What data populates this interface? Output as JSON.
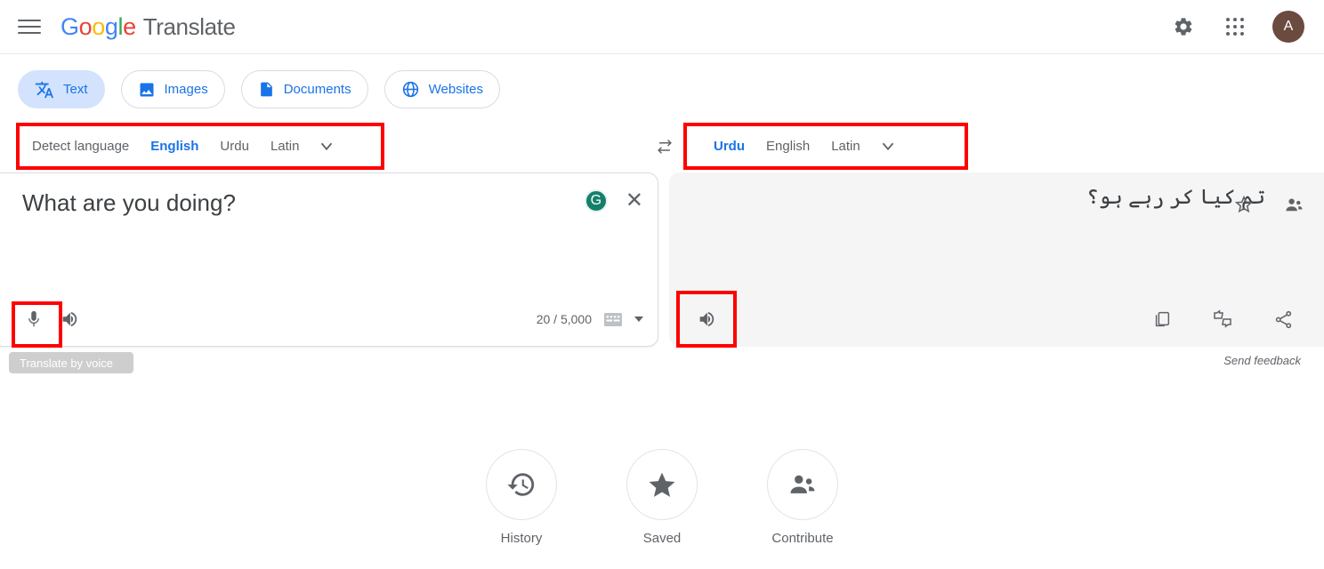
{
  "header": {
    "menu_icon": "hamburger-menu-icon",
    "logo_letters": [
      "G",
      "o",
      "o",
      "g",
      "l",
      "e"
    ],
    "brand_word": "Translate",
    "settings_icon": "gear-icon",
    "apps_icon": "apps-grid-icon",
    "avatar_letter": "A",
    "avatar_color": "#6b4a3f"
  },
  "tabs": [
    {
      "label": "Text",
      "icon": "translate-text-icon",
      "active": true
    },
    {
      "label": "Images",
      "icon": "image-icon",
      "active": false
    },
    {
      "label": "Documents",
      "icon": "document-icon",
      "active": false
    },
    {
      "label": "Websites",
      "icon": "globe-icon",
      "active": false
    }
  ],
  "source_lang": {
    "options": [
      "Detect language",
      "English",
      "Urdu",
      "Latin"
    ],
    "selected": "English",
    "dropdown_icon": "chevron-down-icon"
  },
  "target_lang": {
    "options": [
      "Urdu",
      "English",
      "Latin"
    ],
    "selected": "Urdu",
    "dropdown_icon": "chevron-down-icon"
  },
  "swap_icon": "swap-languages-icon",
  "source_panel": {
    "text": "What are you doing?",
    "grammarly_icon": "grammarly-g-icon",
    "grammarly_letter": "G",
    "close_icon": "close-x-icon",
    "mic_icon": "microphone-icon",
    "speaker_icon": "speaker-icon",
    "char_count": "20 / 5,000",
    "keyboard_icon": "keyboard-icon",
    "keyboard_caret_icon": "caret-down-icon"
  },
  "tooltip": {
    "text": "Translate by voice"
  },
  "output_panel": {
    "text": "تم کیا کر رہے ہو؟",
    "star_icon": "star-outline-icon",
    "contribute_icon": "people-icon",
    "speaker_icon": "speaker-icon",
    "copy_icon": "copy-icon",
    "rate_icon": "thumbs-up-down-icon",
    "share_icon": "share-icon",
    "send_feedback": "Send feedback"
  },
  "bottom_nav": [
    {
      "label": "History",
      "icon": "history-clock-icon"
    },
    {
      "label": "Saved",
      "icon": "star-filled-icon"
    },
    {
      "label": "Contribute",
      "icon": "people-icon"
    }
  ],
  "annotations": {
    "highlight_color": "#ff0000",
    "boxes": [
      "source-language-selector",
      "target-language-selector",
      "microphone-button",
      "output-speaker-button"
    ]
  }
}
